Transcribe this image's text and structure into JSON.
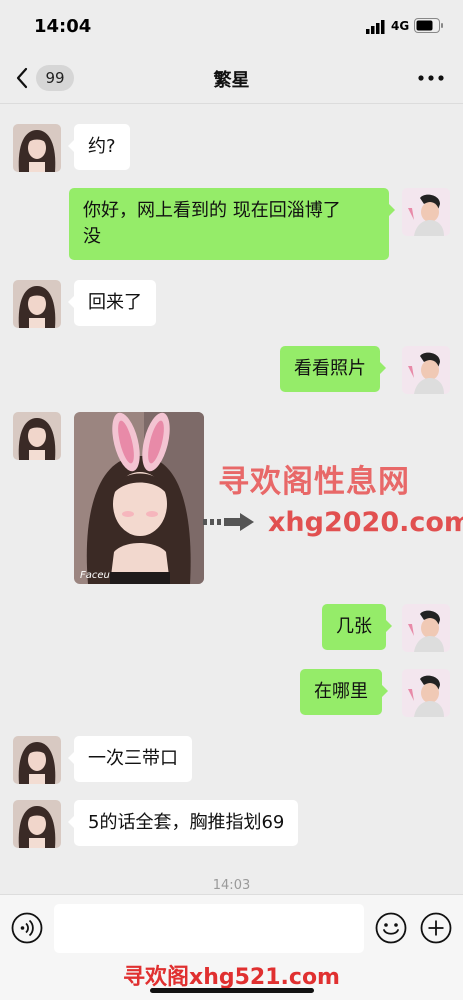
{
  "status_bar": {
    "time": "14:04",
    "network": "4G"
  },
  "nav": {
    "unread_count": "99",
    "title": "繁星"
  },
  "messages": [
    {
      "side": "left",
      "text": "约?"
    },
    {
      "side": "right",
      "text_line1": "你好，网上看到的 现在回淄博了",
      "text_line2": "没"
    },
    {
      "side": "left",
      "text": "回来了"
    },
    {
      "side": "right",
      "text": "看看照片"
    },
    {
      "side": "left",
      "type": "image",
      "caption": "Faceu"
    },
    {
      "side": "right",
      "text": "几张"
    },
    {
      "side": "right",
      "text": "在哪里"
    },
    {
      "side": "left",
      "text": "一次三带口"
    },
    {
      "side": "left",
      "text": "5的话全套，胸推指划69"
    }
  ],
  "watermark": {
    "title": "寻欢阁性息网",
    "url": "xhg2020.com"
  },
  "timestamp": "14:03",
  "input": {
    "placeholder": ""
  },
  "bottom_watermark": "寻欢阁xhg521.com",
  "colors": {
    "background": "#ededed",
    "bubble_self": "#95ec69",
    "bubble_other": "#ffffff"
  },
  "icons": [
    "signal-icon",
    "battery-icon",
    "back-chevron-icon",
    "more-icon",
    "voice-icon",
    "emoji-icon",
    "plus-icon"
  ]
}
